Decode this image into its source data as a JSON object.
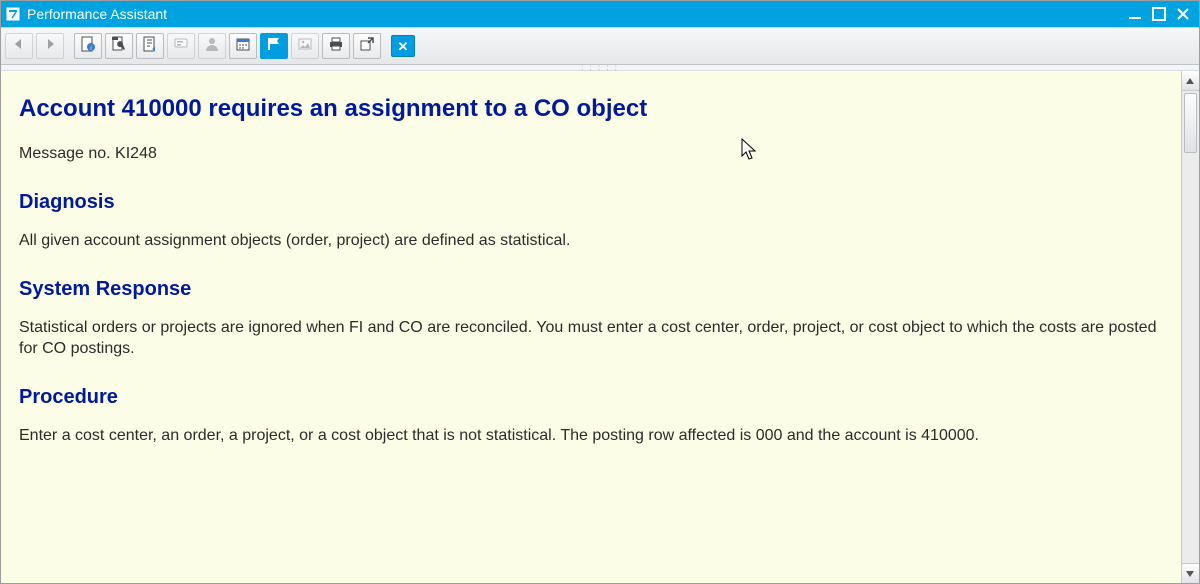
{
  "window": {
    "title": "Performance Assistant"
  },
  "toolbar": {
    "buttons": [
      {
        "name": "back-button",
        "icon": "arrow-left-icon",
        "disabled": true
      },
      {
        "name": "forward-button",
        "icon": "arrow-right-icon",
        "disabled": true
      },
      {
        "name": "doc-info-button",
        "icon": "doc-info-icon",
        "disabled": false
      },
      {
        "name": "tech-info-button",
        "icon": "wrench-doc-icon",
        "disabled": false
      },
      {
        "name": "customize-button",
        "icon": "doc-arrow-icon",
        "disabled": false
      },
      {
        "name": "messages-button",
        "icon": "label-tag-icon",
        "disabled": true
      },
      {
        "name": "user-button",
        "icon": "person-icon",
        "disabled": true
      },
      {
        "name": "calendar-button",
        "icon": "calendar-icon",
        "disabled": false
      },
      {
        "name": "flag-button",
        "icon": "flag-icon",
        "disabled": false,
        "highlight": true
      },
      {
        "name": "breakpoint-button",
        "icon": "picture-icon",
        "disabled": true
      },
      {
        "name": "print-button",
        "icon": "printer-icon",
        "disabled": false
      },
      {
        "name": "export-button",
        "icon": "export-icon",
        "disabled": false
      },
      {
        "name": "close-help-button",
        "icon": "x-icon",
        "disabled": false,
        "closebox": true
      }
    ]
  },
  "doc": {
    "title": "Account 410000 requires an assignment to a CO object",
    "message_no": "Message no. KI248",
    "diagnosis_heading": "Diagnosis",
    "diagnosis_text": "All given account assignment objects (order, project) are defined as statistical.",
    "system_response_heading": "System Response",
    "system_response_text": "Statistical orders or projects are ignored when FI and CO are reconciled. You must enter a cost center, order, project, or cost object to which the costs are posted for CO postings.",
    "procedure_heading": "Procedure",
    "procedure_text": "Enter a cost center, an order, a project, or a cost object that is not statistical. The posting row affected is 000 and the account is 410000."
  }
}
